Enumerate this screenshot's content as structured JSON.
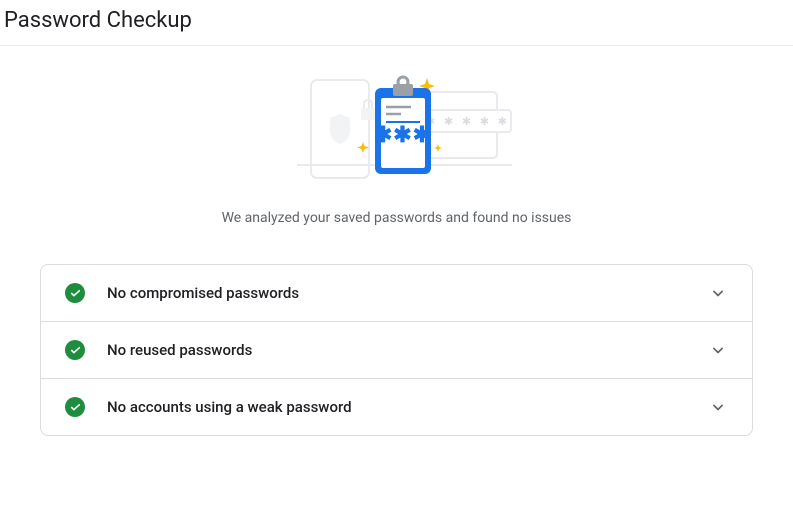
{
  "header": {
    "title": "Password Checkup"
  },
  "summary": {
    "text": "We analyzed your saved passwords and found no issues"
  },
  "results": {
    "item0": {
      "label": "No compromised passwords"
    },
    "item1": {
      "label": "No reused passwords"
    },
    "item2": {
      "label": "No accounts using a weak password"
    }
  }
}
